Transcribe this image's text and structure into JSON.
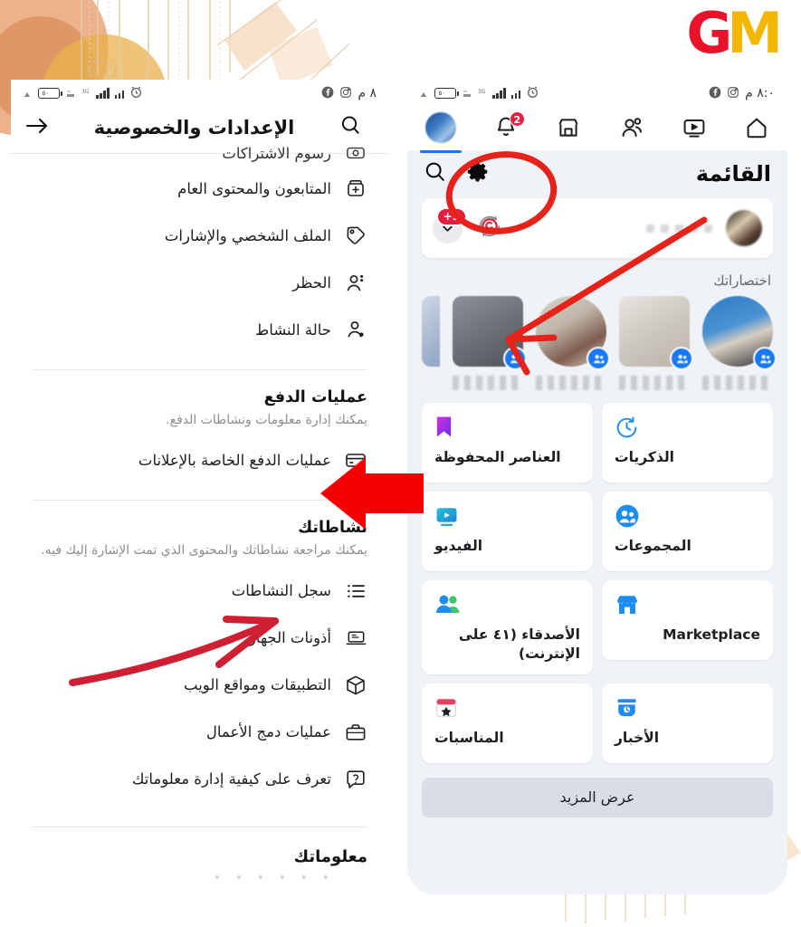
{
  "branding": {
    "logo_g": "G",
    "logo_m": "M"
  },
  "left_phone": {
    "statusbar": {
      "time": "٨ م",
      "icons": [
        "alarm-icon",
        "signal-icon",
        "network-3g-icon",
        "battery-icon",
        "facebook-icon",
        "instagram-icon"
      ]
    },
    "header": {
      "title": "الإعدادات والخصوصية",
      "back_icon": "arrow-right-icon",
      "search_icon": "search-icon",
      "avatar": "user-avatar"
    },
    "clipped_top_item": {
      "label": "رسوم الاشتراكات"
    },
    "menu_items": [
      {
        "label": "المتابعون والمحتوى العام",
        "icon": "followers-add-icon"
      },
      {
        "label": "الملف الشخصي والإشارات",
        "icon": "tag-icon"
      },
      {
        "label": "الحظر",
        "icon": "block-user-icon"
      },
      {
        "label": "حالة النشاط",
        "icon": "activity-status-icon"
      }
    ],
    "payments_section": {
      "title": "عمليات الدفع",
      "subtitle": "يمكنك إدارة معلومات ونشاطات الدفع.",
      "items": [
        {
          "label": "عمليات الدفع الخاصة بالإعلانات",
          "icon": "credit-card-icon"
        }
      ]
    },
    "activity_section": {
      "title": "نشاطاتك",
      "subtitle": "يمكنك مراجعة نشاطاتك والمحتوى الذي تمت الإشارة إليك فيه.",
      "items": [
        {
          "label": "سجل النشاطات",
          "icon": "list-icon"
        },
        {
          "label": "أذونات الجهاز",
          "icon": "laptop-icon"
        },
        {
          "label": "التطبيقات ومواقع الويب",
          "icon": "cube-icon"
        },
        {
          "label": "عمليات دمج الأعمال",
          "icon": "briefcase-icon"
        },
        {
          "label": "تعرف على كيفية إدارة معلوماتك",
          "icon": "question-bubble-icon"
        }
      ]
    },
    "footer_section": {
      "title": "معلوماتك"
    }
  },
  "right_phone": {
    "statusbar": {
      "time": "٨:٠ م",
      "icons": [
        "alarm-icon",
        "signal-icon",
        "network-3g-icon",
        "battery-icon",
        "facebook-icon",
        "instagram-icon"
      ]
    },
    "topnav": [
      {
        "name": "home-icon",
        "label": "الرئيسية"
      },
      {
        "name": "video-icon",
        "label": "الفيديو"
      },
      {
        "name": "friends-icon",
        "label": "الأصدقاء"
      },
      {
        "name": "marketplace-icon",
        "label": "Marketplace"
      },
      {
        "name": "notifications-icon",
        "label": "الإشعارات",
        "badge": "2"
      },
      {
        "name": "menu-avatar",
        "label": "القائمة"
      }
    ],
    "menu_header": {
      "title": "القائمة",
      "gear_icon": "gear-icon",
      "search_icon": "search-icon"
    },
    "profile_card": {
      "avatar": "profile-avatar",
      "badge": "9+",
      "chevron_icon": "chevron-down-icon",
      "refresh_icon": "switch-account-icon"
    },
    "shortcuts": {
      "label": "اختصاراتك",
      "items": [
        {
          "type": "group-shortcut",
          "badge": "group-icon"
        },
        {
          "type": "group-shortcut",
          "badge": "group-icon"
        },
        {
          "type": "group-shortcut",
          "badge": "group-icon"
        },
        {
          "type": "group-shortcut",
          "badge": "group-icon"
        }
      ]
    },
    "tiles": [
      {
        "label": "الذكريات",
        "icon": "memories-clock-icon",
        "color": "#1f8df0",
        "ltr": false
      },
      {
        "label": "العناصر المحفوظة",
        "icon": "bookmark-icon",
        "color": "#a033ff",
        "ltr": false
      },
      {
        "label": "المجموعات",
        "icon": "groups-icon",
        "color": "#1f8df0",
        "ltr": false
      },
      {
        "label": "الفيديو",
        "icon": "video-tile-icon",
        "color": "#18aebf",
        "ltr": false
      },
      {
        "label": "Marketplace",
        "icon": "marketplace-tile-icon",
        "color": "#1f8df0",
        "ltr": true
      },
      {
        "label": "الأصدقاء (٤١ على الإنترنت)",
        "icon": "friends-tile-icon",
        "color": "#1f8df0",
        "ltr": false
      },
      {
        "label": "الأخبار",
        "icon": "news-icon",
        "color": "#1f8df0",
        "ltr": false
      },
      {
        "label": "المناسبات",
        "icon": "events-icon",
        "color": "#e4405f",
        "ltr": false
      }
    ],
    "show_more": {
      "label": "عرض المزيد"
    }
  },
  "annotations": {
    "accent_color": "#e5231b",
    "marks": [
      {
        "name": "gear-highlight-circle",
        "target": "gear-icon"
      },
      {
        "name": "arrow-to-gear",
        "target": "gear-icon"
      },
      {
        "name": "arrow-to-ads-payments",
        "target": "ads-payments-row"
      },
      {
        "name": "arrow-to-activity-log",
        "target": "activity-log-row"
      }
    ]
  }
}
